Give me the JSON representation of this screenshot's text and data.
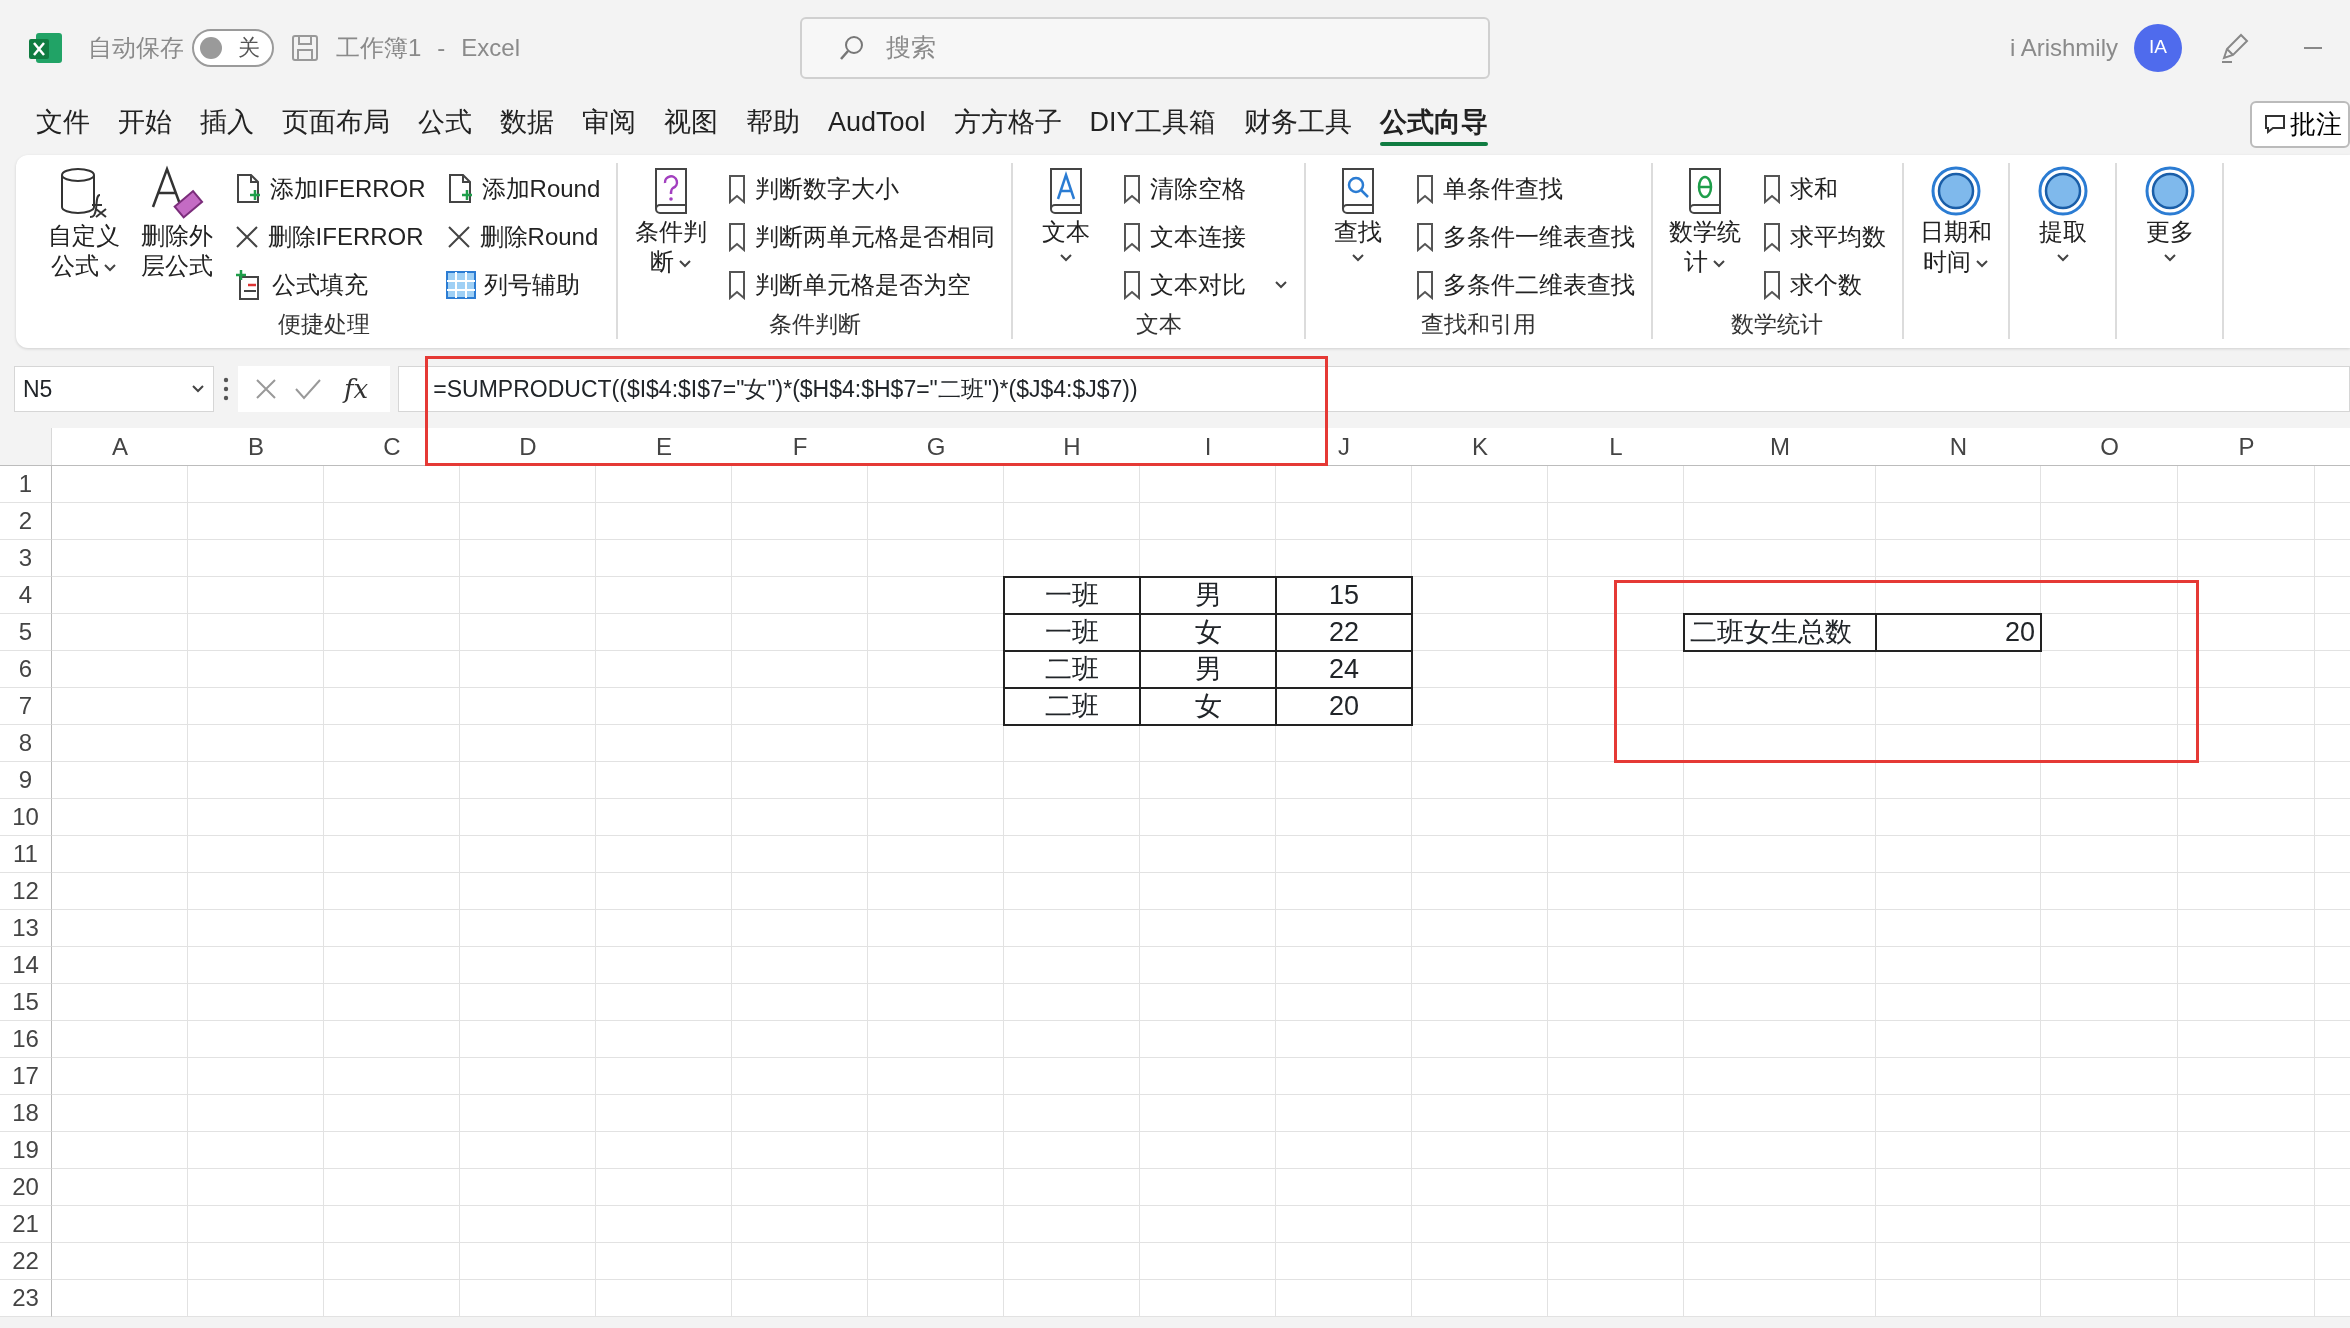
{
  "title_bar": {
    "autosave_label": "自动保存",
    "autosave": {
      "on": false,
      "label": "关"
    },
    "document": "工作簿1",
    "separator": "-",
    "app": "Excel",
    "search": {
      "placeholder": "搜索"
    },
    "user": "i Arishmily",
    "avatar": "IA"
  },
  "menu_tabs": [
    {
      "label": "文件",
      "selected": false
    },
    {
      "label": "开始",
      "selected": false
    },
    {
      "label": "插入",
      "selected": false
    },
    {
      "label": "页面布局",
      "selected": false
    },
    {
      "label": "公式",
      "selected": false
    },
    {
      "label": "数据",
      "selected": false
    },
    {
      "label": "审阅",
      "selected": false
    },
    {
      "label": "视图",
      "selected": false
    },
    {
      "label": "帮助",
      "selected": false
    },
    {
      "label": "AudTool",
      "selected": false
    },
    {
      "label": "方方格子",
      "selected": false
    },
    {
      "label": "DIY工具箱",
      "selected": false
    },
    {
      "label": "财务工具",
      "selected": false
    },
    {
      "label": "公式向导",
      "selected": true
    }
  ],
  "comments_button": {
    "label": "批注"
  },
  "ribbon": {
    "groups": [
      {
        "label": "便捷处理",
        "items": [
          {
            "kind": "large",
            "label": "自定义公式",
            "dropdown": true
          },
          {
            "kind": "large",
            "label": "删除外层公式",
            "dropdown": false
          },
          {
            "kind": "small",
            "label": "添加IFERROR"
          },
          {
            "kind": "small",
            "label": "删除IFERROR"
          },
          {
            "kind": "small",
            "label": "公式填充"
          },
          {
            "kind": "small",
            "label": "添加Round"
          },
          {
            "kind": "small",
            "label": "删除Round"
          },
          {
            "kind": "small",
            "label": "列号辅助"
          }
        ]
      },
      {
        "label": "条件判断",
        "items": [
          {
            "kind": "large",
            "label": "条件判断",
            "dropdown": true
          },
          {
            "kind": "small",
            "label": "判断数字大小"
          },
          {
            "kind": "small",
            "label": "判断两单元格是否相同"
          },
          {
            "kind": "small",
            "label": "判断单元格是否为空"
          }
        ]
      },
      {
        "label": "文本",
        "items": [
          {
            "kind": "large",
            "label": "文本",
            "dropdown": true
          },
          {
            "kind": "small",
            "label": "清除空格"
          },
          {
            "kind": "small",
            "label": "文本连接"
          },
          {
            "kind": "small",
            "label": "文本对比",
            "dropdown": true
          }
        ]
      },
      {
        "label": "查找和引用",
        "items": [
          {
            "kind": "large",
            "label": "查找",
            "dropdown": true
          },
          {
            "kind": "small",
            "label": "单条件查找"
          },
          {
            "kind": "small",
            "label": "多条件一维表查找"
          },
          {
            "kind": "small",
            "label": "多条件二维表查找"
          }
        ]
      },
      {
        "label": "数学统计",
        "items": [
          {
            "kind": "large",
            "label": "数学统计",
            "dropdown": true
          },
          {
            "kind": "small",
            "label": "求和"
          },
          {
            "kind": "small",
            "label": "求平均数"
          },
          {
            "kind": "small",
            "label": "求个数"
          }
        ]
      },
      {
        "items": [
          {
            "kind": "large",
            "label": "日期和时间",
            "dropdown": true
          }
        ]
      },
      {
        "items": [
          {
            "kind": "large",
            "label": "提取",
            "dropdown": true
          }
        ]
      },
      {
        "items": [
          {
            "kind": "large",
            "label": "更多",
            "dropdown": true
          }
        ]
      }
    ]
  },
  "formula_bar": {
    "name_box": "N5",
    "function_button": "fx",
    "formula": "=SUMPRODUCT(($I$4:$I$7=\"女\")*($H$4:$H$7=\"二班\")*($J$4:$J$7))"
  },
  "sheet": {
    "columns": [
      "A",
      "B",
      "C",
      "D",
      "E",
      "F",
      "G",
      "H",
      "I",
      "J",
      "K",
      "L",
      "M",
      "N",
      "O",
      "P"
    ],
    "rows": [
      {
        "number": "1"
      },
      {
        "number": "2"
      },
      {
        "number": "3"
      },
      {
        "number": "4",
        "cells": [
          null,
          null,
          null,
          null,
          null,
          null,
          null,
          {
            "text": "一班",
            "bordered": true,
            "centered": true
          },
          {
            "text": "男",
            "bordered": true,
            "centered": true
          },
          {
            "text": "15",
            "bordered": true,
            "centered": true
          }
        ]
      },
      {
        "number": "5",
        "cells": [
          null,
          null,
          null,
          null,
          null,
          null,
          null,
          {
            "text": "一班",
            "bordered": true,
            "centered": true
          },
          {
            "text": "女",
            "bordered": true,
            "centered": true
          },
          {
            "text": "22",
            "bordered": true,
            "centered": true
          },
          null,
          null,
          {
            "text": "二班女生总数",
            "bordered": true,
            "centered": false
          },
          {
            "text": "20",
            "bordered": true,
            "centered": false,
            "right_aligned": true
          }
        ]
      },
      {
        "number": "6",
        "cells": [
          null,
          null,
          null,
          null,
          null,
          null,
          null,
          {
            "text": "二班",
            "bordered": true,
            "centered": true
          },
          {
            "text": "男",
            "bordered": true,
            "centered": true
          },
          {
            "text": "24",
            "bordered": true,
            "centered": true
          }
        ]
      },
      {
        "number": "7",
        "cells": [
          null,
          null,
          null,
          null,
          null,
          null,
          null,
          {
            "text": "二班",
            "bordered": true,
            "centered": true
          },
          {
            "text": "女",
            "bordered": true,
            "centered": true
          },
          {
            "text": "20",
            "bordered": true,
            "centered": true
          }
        ]
      },
      {
        "number": "8"
      },
      {
        "number": "9"
      },
      {
        "number": "10"
      },
      {
        "number": "11"
      },
      {
        "number": "12"
      },
      {
        "number": "13"
      },
      {
        "number": "14"
      },
      {
        "number": "15"
      },
      {
        "number": "16"
      },
      {
        "number": "17"
      },
      {
        "number": "18"
      },
      {
        "number": "19"
      },
      {
        "number": "20"
      },
      {
        "number": "21"
      },
      {
        "number": "22"
      },
      {
        "number": "23"
      }
    ]
  },
  "annotations": [
    {
      "kind": "frame"
    },
    {
      "kind": "frame"
    }
  ]
}
